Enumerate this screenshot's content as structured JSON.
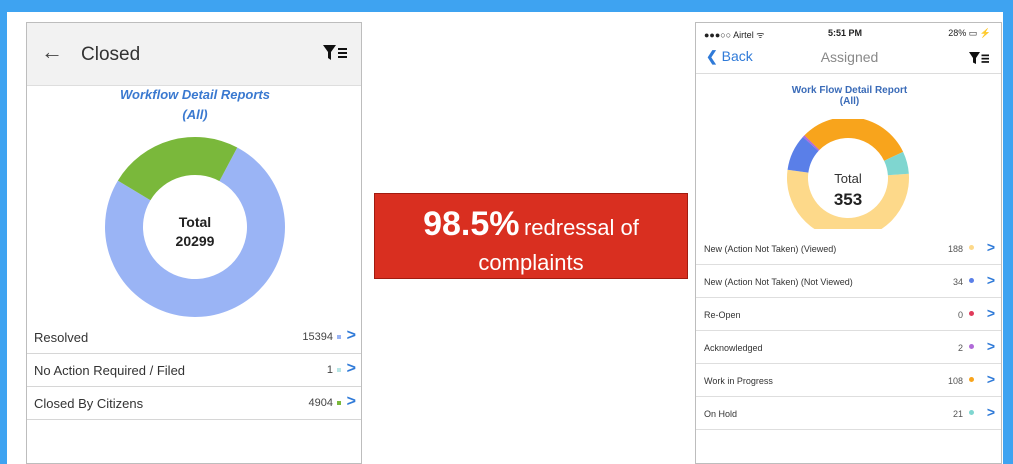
{
  "left_screen": {
    "header": {
      "back_icon": "arrow-left-icon",
      "title": "Closed",
      "filter_icon": "filter-icon"
    },
    "report_title_line1": "Workflow Detail Reports",
    "report_title_line2": "(All)",
    "total_label": "Total",
    "total_value": "20299",
    "rows": [
      {
        "label": "Resolved",
        "value": "15394",
        "color": "#9ab4f5"
      },
      {
        "label": "No Action Required / Filed",
        "value": "1",
        "color": "#b8e6e6"
      },
      {
        "label": "Closed By Citizens",
        "value": "4904",
        "color": "#7ab83b"
      }
    ],
    "chevron_icon": "chevron-right-icon"
  },
  "banner": {
    "percent": "98.5%",
    "text_line1": "redressal of",
    "text_line2": "complaints",
    "color": "#d92f20"
  },
  "right_screen": {
    "status_bar": {
      "carrier": "●●●○○ Airtel ᯤ",
      "time": "5:51 PM",
      "battery": "28% ▭ ⚡"
    },
    "nav": {
      "back_label": "Back",
      "title": "Assigned",
      "filter_icon": "filter-icon"
    },
    "report_title_line1": "Work Flow Detail Report",
    "report_title_line2": "(All)",
    "total_label": "Total",
    "total_value": "353",
    "rows": [
      {
        "label": "New (Action Not Taken) (Viewed)",
        "value": "188",
        "color": "#fdd98a"
      },
      {
        "label": "New (Action Not Taken) (Not Viewed)",
        "value": "34",
        "color": "#5a7fe8"
      },
      {
        "label": "Re-Open",
        "value": "0",
        "color": "#e03a5a"
      },
      {
        "label": "Acknowledged",
        "value": "2",
        "color": "#b06ad8"
      },
      {
        "label": "Work in Progress",
        "value": "108",
        "color": "#f8a41c"
      },
      {
        "label": "On Hold",
        "value": "21",
        "color": "#7fd6d0"
      }
    ]
  }
}
